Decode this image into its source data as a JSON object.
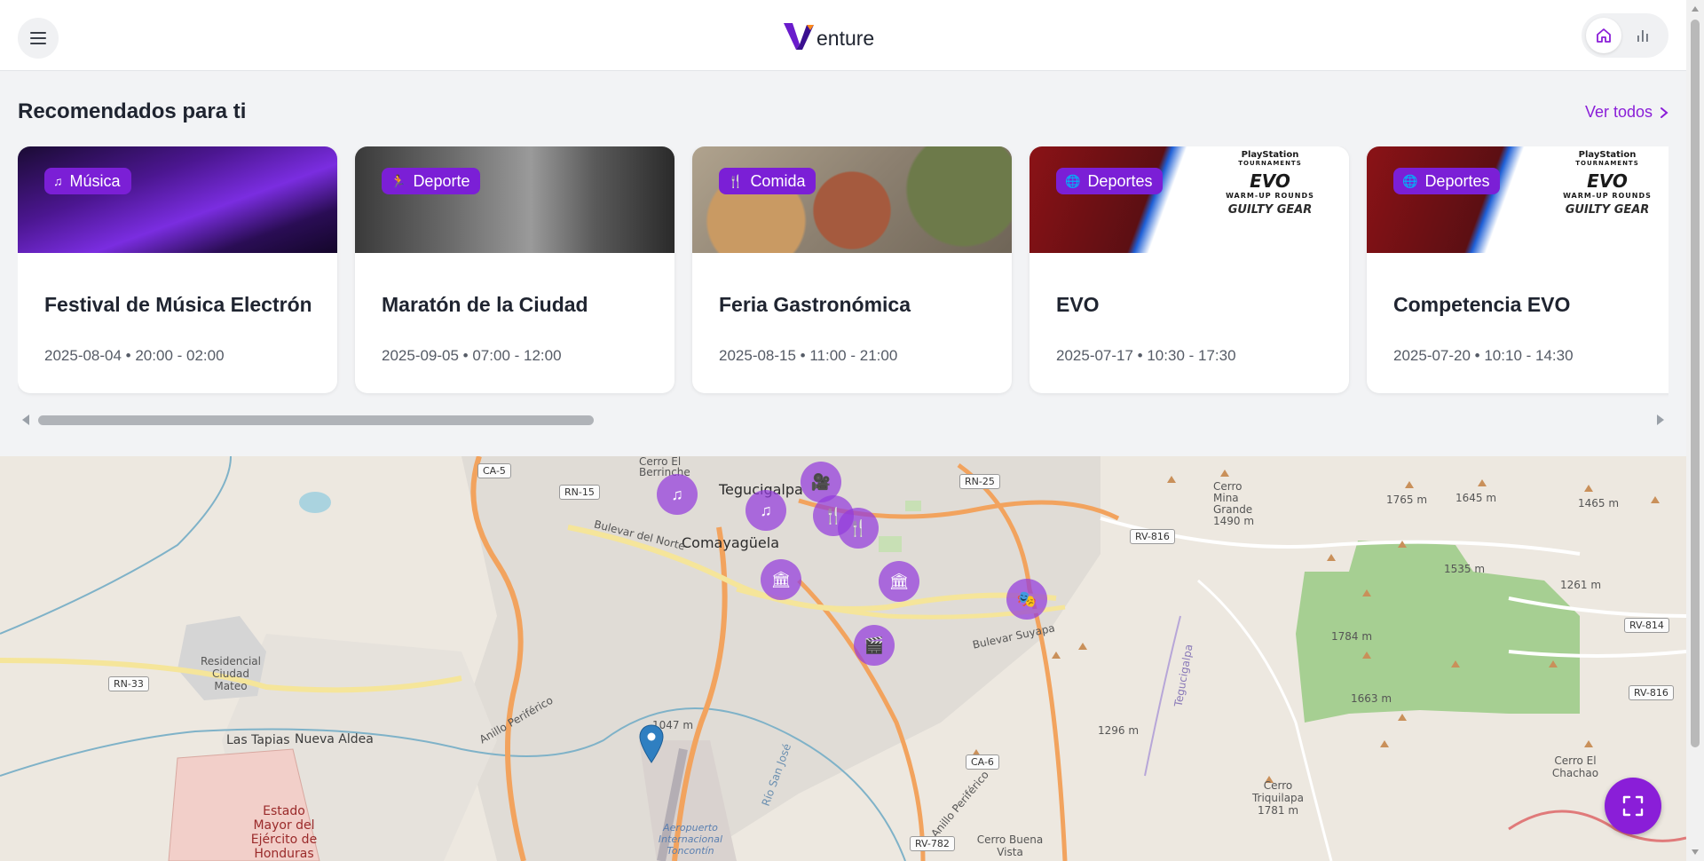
{
  "header": {
    "logo_text": "enture",
    "menu_icon": "hamburger-menu-icon",
    "nav": [
      {
        "name": "home",
        "icon": "home-icon",
        "active": true
      },
      {
        "name": "stats",
        "icon": "bar-chart-icon",
        "active": false
      }
    ]
  },
  "recommended": {
    "title": "Recomendados para ti",
    "see_all": "Ver todos",
    "cards": [
      {
        "category": "Música",
        "category_icon": "music-note-icon",
        "title": "Festival de Música Electrónica",
        "date": "2025-08-04 • 20:00 - 02:00"
      },
      {
        "category": "Deporte",
        "category_icon": "running-icon",
        "title": "Maratón de la Ciudad",
        "date": "2025-09-05 • 07:00 - 12:00"
      },
      {
        "category": "Comida",
        "category_icon": "fork-knife-icon",
        "title": "Feria Gastronómica",
        "date": "2025-08-15 • 11:00 - 21:00"
      },
      {
        "category": "Deportes",
        "category_icon": "globe-icon",
        "title": "EVO",
        "date": "2025-07-17 • 10:30 - 17:30"
      },
      {
        "category": "Deportes",
        "category_icon": "globe-icon",
        "title": "Competencia EVO",
        "date": "2025-07-20 • 10:10 - 14:30"
      }
    ],
    "evo_banner": {
      "brand": "PlayStation",
      "sub": "TOURNAMENTS",
      "logo": "EVO",
      "line": "WARM-UP ROUNDS",
      "game": "GUILTY GEAR"
    }
  },
  "map": {
    "labels": {
      "tegucigalpa": "Tegucigalpa",
      "comayaguela": "Comayagüela",
      "las_tapias": "Las Tapias",
      "nueva_aldea": "Nueva Aldea",
      "residencial": "Residencial Ciudad Mateo",
      "estado_mayor": "Estado Mayor del Ejército de Honduras",
      "aeropuerto": "Aeropuerto Internacional Toncontín",
      "cerro_el_berrinche": "Cerro El Berrinche",
      "cerro_mina_grande": "Cerro Mina Grande 1490 m",
      "cerro_triquilapa": "Cerro Triquilapa 1781 m",
      "cerro_buena_vista": "Cerro Buena Vista",
      "cerro_el_chachao": "Cerro El Chachao",
      "bulevar_del_norte": "Bulevar del Norte",
      "bulevar_suyapa": "Bulevar Suyapa",
      "anillo_periferico": "Anillo Periférico",
      "rio_tegucigalpa": "Tegucigalpa",
      "rio_san_jose": "Río San José",
      "elev_1765": "1765 m",
      "elev_1645": "1645 m",
      "elev_1465": "1465 m",
      "elev_1535": "1535 m",
      "elev_1261": "1261 m",
      "elev_1784": "1784 m",
      "elev_1663": "1663 m",
      "elev_1296": "1296 m",
      "elev_1047": "1047 m"
    },
    "shields": {
      "ca5": "CA-5",
      "rn15": "RN-15",
      "rn25": "RN-25",
      "rn33": "RN-33",
      "rv816a": "RV-816",
      "rv816b": "RV-816",
      "rv814": "RV-814",
      "ca6": "CA-6",
      "rv782": "RV-782"
    },
    "markers": [
      {
        "icon": "music-note-icon",
        "glyph": "♫"
      },
      {
        "icon": "music-note-icon",
        "glyph": "♫"
      },
      {
        "icon": "camera-icon",
        "glyph": "🎥"
      },
      {
        "icon": "food-icon",
        "glyph": "🍴"
      },
      {
        "icon": "food-icon",
        "glyph": "🍴"
      },
      {
        "icon": "museum-icon",
        "glyph": "🏛"
      },
      {
        "icon": "museum-icon",
        "glyph": "🏛"
      },
      {
        "icon": "theater-icon",
        "glyph": "🎭"
      },
      {
        "icon": "film-icon",
        "glyph": "🎬"
      }
    ],
    "location_pin_icon": "location-pin-icon",
    "fullscreen_icon": "fullscreen-icon"
  },
  "colors": {
    "accent": "#8a1ed8",
    "tag": "#7b1fd6",
    "marker": "#933cdc",
    "pin": "#2f7fc1"
  }
}
